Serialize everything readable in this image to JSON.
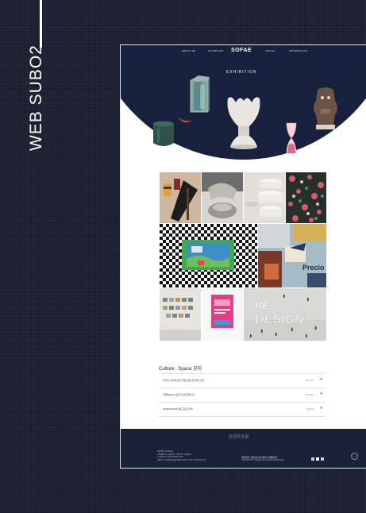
{
  "side_title": "WEB SUBO2",
  "header": {
    "nav_left": [
      "ABOUT ME",
      "EXHIBITION"
    ],
    "logo": "SOFAE",
    "nav_right": [
      "JOINUS",
      "INFORMATION"
    ]
  },
  "hero": {
    "title": "EXHIBITION"
  },
  "gallery": {
    "tiles": [
      "film-roll-art",
      "hands-pottery",
      "white-ceramic-bowls",
      "floral-pattern",
      "checkered-frame-art",
      "collage-precio",
      "photo-wall-exhibition",
      "pink-poster",
      "re-design-installation"
    ],
    "re_design_text": "RE-\nDESIGN",
    "precio_text": "Precio"
  },
  "notice": {
    "title": "Culture : Space 공지",
    "items": [
      {
        "text": "디자인 아카이브의 전환 운영 및 확인 안내",
        "date": "22.10.1"
      },
      {
        "text": "카페&Space 휴관 안내드립니다",
        "date": "22.9.12"
      },
      {
        "text": "MOMA MOVA 발도 휴관 안내",
        "date": "22.8.3"
      }
    ]
  },
  "footer": {
    "logo": "SOFAE",
    "info": [
      "BRAND: SOFAE",
      "ADDRESS: SEOUL, 000-00, KOREA",
      "CONTACT: 0000-0000-0000",
      "EMAIL: SAMPLE@SOFAE.COM / FAX: 02-0000-000"
    ],
    "links": "이용약관 | 개인정보 처리방침 | 이메일무단",
    "copyright": "COPYRIGHT © SOFAE ALL RIGHTS RESERVED",
    "top_label": "^"
  },
  "colors": {
    "navy": "#17213b",
    "footer": "#1a2238",
    "accent_logo": "#ffffff"
  }
}
